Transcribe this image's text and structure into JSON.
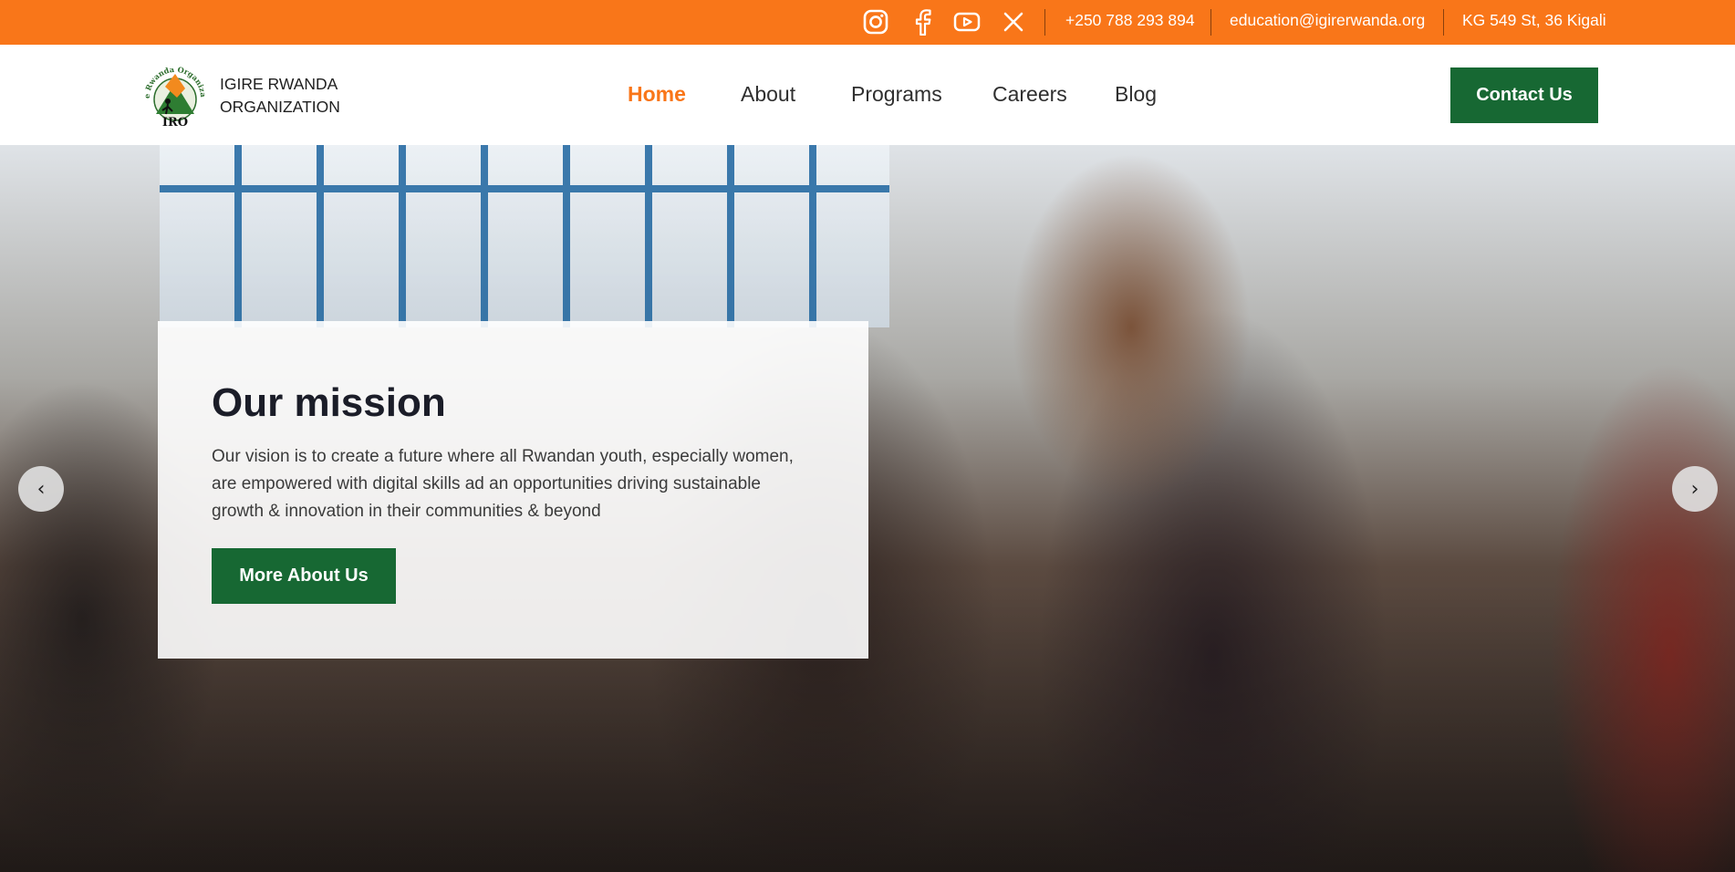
{
  "colors": {
    "accent": "#f97619",
    "brand_green": "#176833",
    "text_dark": "#1b1d28"
  },
  "topbar": {
    "social": [
      {
        "icon": "instagram-icon"
      },
      {
        "icon": "facebook-icon"
      },
      {
        "icon": "youtube-icon"
      },
      {
        "icon": "x-twitter-icon"
      }
    ],
    "phone": "+250 788 293 894",
    "email": "education@igirerwanda.org",
    "address": "KG 549 St, 36 Kigali"
  },
  "header": {
    "logo": {
      "text_top": "Igire Rwanda Organization",
      "text_bottom": "IRO"
    },
    "brand_line1": "IGIRE RWANDA",
    "brand_line2": "ORGANIZATION",
    "nav": [
      {
        "label": "Home",
        "active": true
      },
      {
        "label": "About",
        "active": false
      },
      {
        "label": "Programs",
        "active": false
      },
      {
        "label": "Careers",
        "active": false
      },
      {
        "label": "Blog",
        "active": false
      }
    ],
    "contact_label": "Contact Us"
  },
  "hero": {
    "title": "Our mission",
    "text": "Our vision is to create a future where all Rwandan youth, especially women, are empowered with digital skills ad an opportunities driving sustainable growth & innovation in their communities & beyond",
    "button_label": "More About Us",
    "prev_icon": "chevron-left-icon",
    "next_icon": "chevron-right-icon",
    "prev_glyph": "‹",
    "next_glyph": "›"
  }
}
